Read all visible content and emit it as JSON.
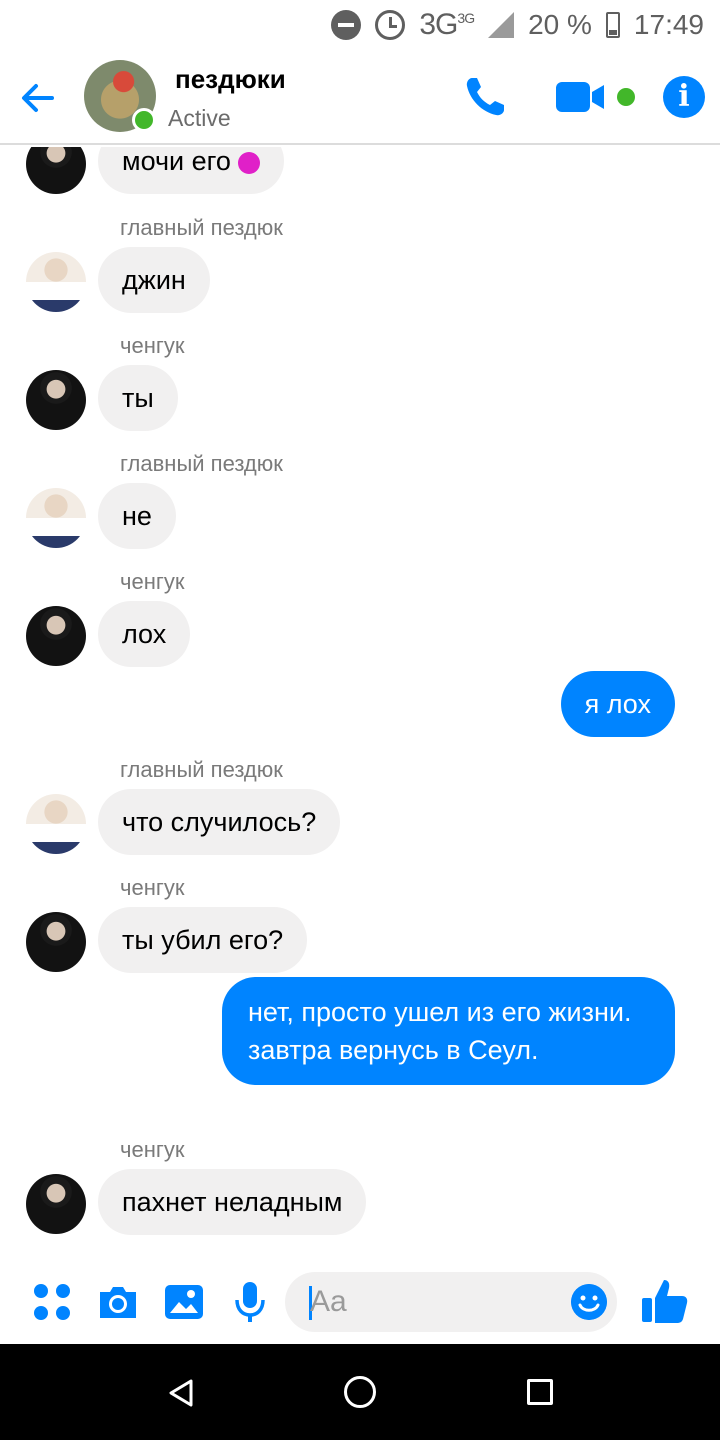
{
  "status_bar": {
    "network": "3G",
    "network_super": "3G",
    "battery": "20 %",
    "time": "17:49"
  },
  "header": {
    "title": "пездюки",
    "status": "Active",
    "info_symbol": "i"
  },
  "messages": [
    {
      "sender": "",
      "text": "мочи его",
      "mine": false,
      "avatar": "jk"
    },
    {
      "sender": "главный пездюк",
      "text": "джин",
      "mine": false,
      "avatar": "jin"
    },
    {
      "sender": "ченгук",
      "text": "ты",
      "mine": false,
      "avatar": "jk"
    },
    {
      "sender": "главный пездюк",
      "text": "не",
      "mine": false,
      "avatar": "jin"
    },
    {
      "sender": "ченгук",
      "text": "лох",
      "mine": false,
      "avatar": "jk"
    },
    {
      "sender": "",
      "text": "я лох",
      "mine": true
    },
    {
      "sender": "главный пездюк",
      "text": "что случилось?",
      "mine": false,
      "avatar": "jin"
    },
    {
      "sender": "ченгук",
      "text": "ты убил его?",
      "mine": false,
      "avatar": "jk"
    },
    {
      "sender": "",
      "text": "нет, просто ушел из его жизни. завтра вернусь в Сеул.",
      "mine": true
    },
    {
      "sender": "ченгук",
      "text": "пахнет неладным",
      "mine": false,
      "avatar": "jk"
    }
  ],
  "composer": {
    "placeholder": "Aa"
  },
  "colors": {
    "accent": "#0084ff",
    "online": "#42b72a",
    "incoming_bubble": "#f1f0f0"
  },
  "icons": [
    "back-arrow-icon",
    "phone-icon",
    "video-camera-icon",
    "info-icon",
    "more-dots-icon",
    "camera-icon",
    "image-icon",
    "microphone-icon",
    "emoji-icon",
    "thumbs-up-icon"
  ]
}
